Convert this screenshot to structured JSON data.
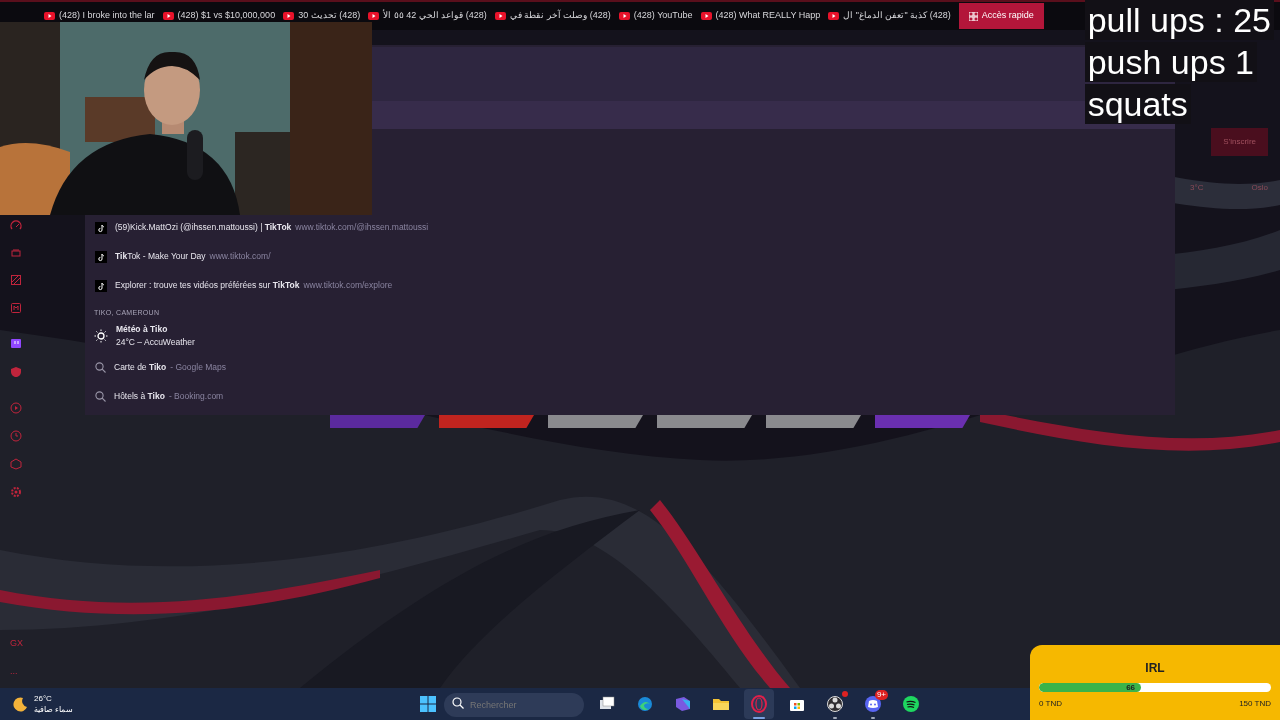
{
  "bookmarks": [
    {
      "label": "(428) I broke into the lar",
      "kind": "youtube"
    },
    {
      "label": "(428) $1 vs $10,000,000",
      "kind": "youtube"
    },
    {
      "label": "(428) تحديث 30",
      "kind": "youtube"
    },
    {
      "label": "(428) قواعد الحي 42 ٥٥ الأ",
      "kind": "youtube"
    },
    {
      "label": "(428) وصلت آخر نقطة في",
      "kind": "youtube"
    },
    {
      "label": "(428) YouTube",
      "kind": "youtube"
    },
    {
      "label": "(428) What REALLY Happ",
      "kind": "youtube"
    },
    {
      "label": "(428) كذبة \"تعفن الدماغ\" ال",
      "kind": "youtube"
    },
    {
      "label": "Accès rapide",
      "kind": "speed-dial"
    }
  ],
  "suggestions": {
    "rows": [
      {
        "title": "(59)Kick.MattOzi (@ihssen.mattoussi) | **TikTok**",
        "url": "www.tiktok.com/@ihssen.mattoussi",
        "kind": "tiktok"
      },
      {
        "title": "**Tik**Tok - Make Your Day",
        "url": "www.tiktok.com/",
        "kind": "tiktok"
      },
      {
        "title": "Explorer : trouve tes vidéos préférées sur **TikTok**",
        "url": "www.tiktok.com/explore",
        "kind": "tiktok"
      }
    ],
    "section_heading": "TIKO, CAMEROUN",
    "weather": {
      "title": "Météo à Tiko",
      "detail": "24°C – AccuWeather"
    },
    "searches": [
      {
        "title": "Carte de **Tiko**",
        "source": "- Google Maps"
      },
      {
        "title": "Hôtels à **Tiko**",
        "source": "- Booking.com"
      }
    ]
  },
  "background_page": {
    "signup_button": "S'inscrire",
    "temperature": "3°C",
    "city": "Oslo"
  },
  "tiles": [
    {
      "color": "#5b2a9e"
    },
    {
      "color": "#c0241f"
    },
    {
      "color": "#8a8a8e"
    },
    {
      "color": "#8a8a8e"
    },
    {
      "color": "#8a8a8e"
    },
    {
      "color": "#6a2fb0"
    }
  ],
  "sidebar_footer": {
    "logo": "GX",
    "more": "..."
  },
  "overlay": {
    "lines": [
      "pull ups : 25",
      "push ups 1",
      "squats"
    ]
  },
  "taskbar": {
    "weather": {
      "temperature": "26°C",
      "condition": "سماء صافية"
    },
    "search": {
      "placeholder": "Rechercher"
    },
    "apps": [
      {
        "kind": "task-view",
        "active": false,
        "running": false
      },
      {
        "kind": "edge",
        "active": false,
        "running": false
      },
      {
        "kind": "office",
        "active": false,
        "running": false
      },
      {
        "kind": "folder",
        "active": false,
        "running": false
      },
      {
        "kind": "opera",
        "active": true,
        "running": true
      },
      {
        "kind": "store",
        "active": false,
        "running": false
      },
      {
        "kind": "obs",
        "active": false,
        "running": true,
        "badge_dot": true
      },
      {
        "kind": "discord",
        "active": false,
        "running": true,
        "badge": "9+"
      },
      {
        "kind": "spotify",
        "active": false,
        "running": false
      }
    ]
  },
  "donation_goal": {
    "title": "IRL",
    "level": 0.44,
    "reading": "66",
    "min": "0 TND",
    "max": "150 TND"
  }
}
